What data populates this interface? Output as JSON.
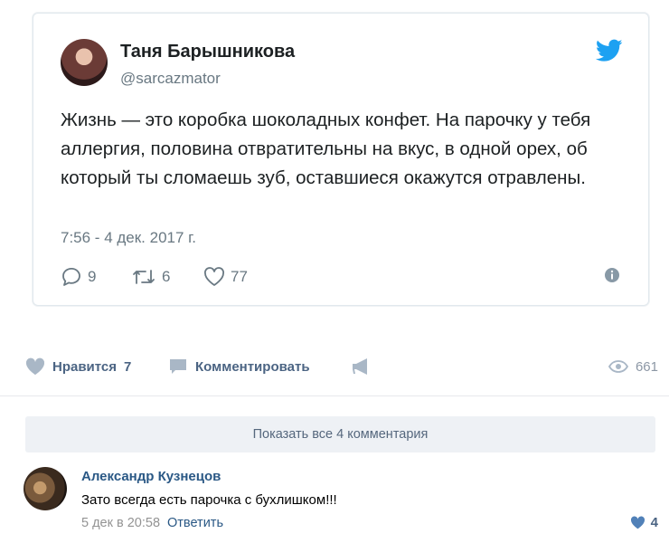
{
  "tweet": {
    "author_name": "Таня Барышникова",
    "handle": "@sarcazmator",
    "text": "Жизнь — это коробка шоколадных конфет. На парочку у тебя аллергия, половина отвратительны на вкус, в одной орех, об который ты сломаешь зуб, оставшиеся окажутся отравлены.",
    "timestamp": "7:56 - 4 дек. 2017 г.",
    "replies": "9",
    "retweets": "6",
    "likes": "77",
    "brand_color": "#1da1f2"
  },
  "post_actions": {
    "like_label": "Нравится",
    "like_count": "7",
    "comment_label": "Комментировать",
    "views": "661"
  },
  "comments": {
    "show_all_label": "Показать все 4 комментария",
    "items": [
      {
        "author": "Александр Кузнецов",
        "text": "Зато всегда есть парочка с бухлишком!!!",
        "date": "5 дек в 20:58",
        "reply_label": "Ответить",
        "likes": "4"
      }
    ]
  }
}
